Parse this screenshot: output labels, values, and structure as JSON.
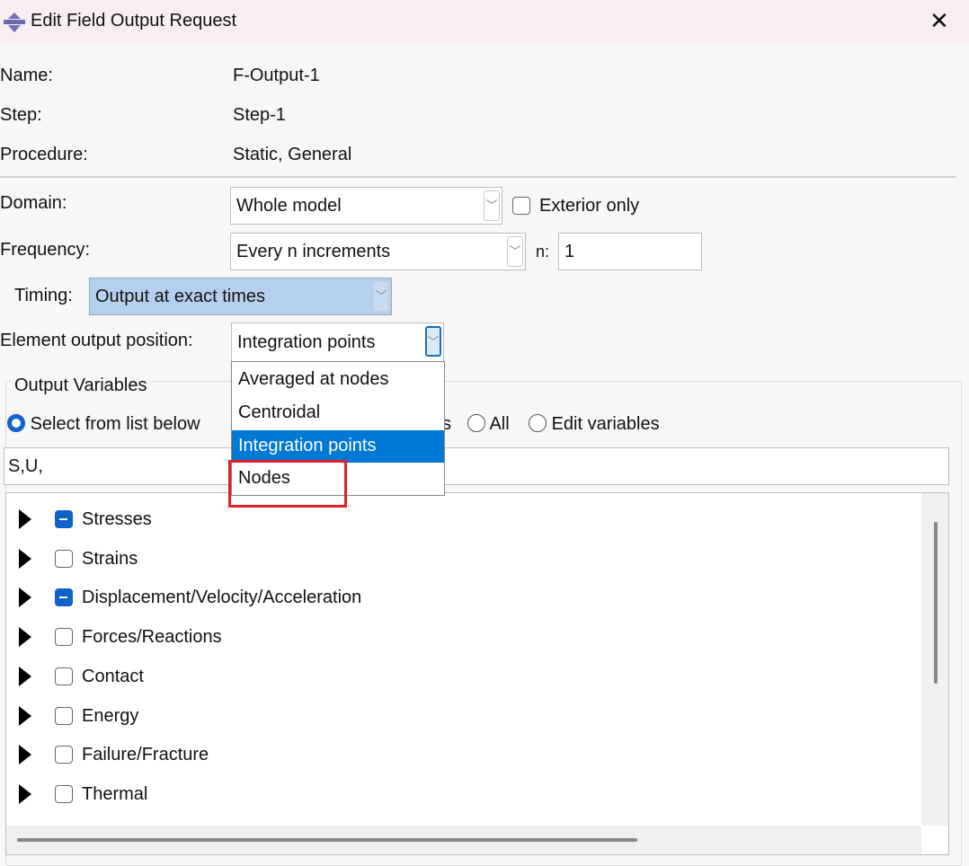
{
  "window": {
    "title": "Edit Field Output Request",
    "icon": "abaqus-app-icon",
    "close_icon": "close-icon"
  },
  "info": {
    "name_label": "Name:",
    "name_value": "F-Output-1",
    "step_label": "Step:",
    "step_value": "Step-1",
    "procedure_label": "Procedure:",
    "procedure_value": "Static, General"
  },
  "domain": {
    "label": "Domain:",
    "value": "Whole model",
    "exterior_label": "Exterior only",
    "exterior_checked": false
  },
  "frequency": {
    "label": "Frequency:",
    "value": "Every n increments",
    "n_label": "n:",
    "n_value": "1"
  },
  "timing": {
    "label": "Timing:",
    "value": "Output at exact times"
  },
  "element_position": {
    "label": "Element output position:",
    "value": "Integration points",
    "options": [
      "Averaged at nodes",
      "Centroidal",
      "Integration points",
      "Nodes"
    ],
    "highlighted": "Integration points",
    "annotated": "Nodes",
    "annotation_color": "#e0202a"
  },
  "output_variables": {
    "group_label": "Output Variables",
    "radios": [
      {
        "label": "Select from list below",
        "selected": true
      },
      {
        "label": "s",
        "selected": false
      },
      {
        "label": "All",
        "selected": false
      },
      {
        "label": "Edit variables",
        "selected": false
      }
    ],
    "text_value": "S,U,",
    "tree": [
      {
        "label": "Stresses",
        "state": "mixed"
      },
      {
        "label": "Strains",
        "state": "unchecked"
      },
      {
        "label": "Displacement/Velocity/Acceleration",
        "state": "mixed"
      },
      {
        "label": "Forces/Reactions",
        "state": "unchecked"
      },
      {
        "label": "Contact",
        "state": "unchecked"
      },
      {
        "label": "Energy",
        "state": "unchecked"
      },
      {
        "label": "Failure/Fracture",
        "state": "unchecked"
      },
      {
        "label": "Thermal",
        "state": "unchecked"
      }
    ]
  },
  "colors": {
    "accent": "#0078d4",
    "checkbox": "#0f62c8",
    "timing_bg": "#b5d0ec"
  }
}
